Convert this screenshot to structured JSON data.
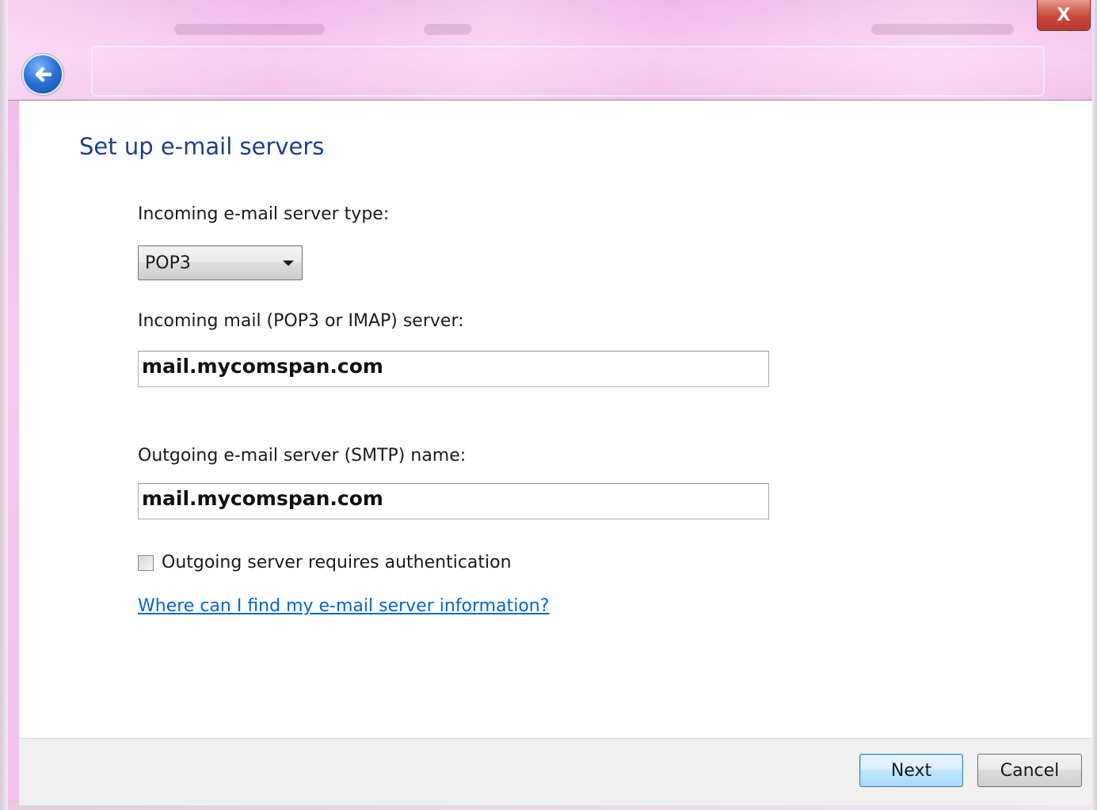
{
  "window": {
    "close_glyph": "X",
    "accent_color": "#1e3f8c"
  },
  "nav": {
    "back_icon": "back-arrow-icon"
  },
  "page": {
    "heading": "Set up e-mail servers"
  },
  "form": {
    "incoming_type_label": "Incoming e-mail server type:",
    "incoming_type_value": "POP3",
    "incoming_server_label": "Incoming mail (POP3 or IMAP) server:",
    "incoming_server_value": "mail.mycomspan.com",
    "outgoing_server_label": "Outgoing e-mail server (SMTP) name:",
    "outgoing_server_value": "mail.mycomspan.com",
    "auth_checkbox_label": "Outgoing server requires authentication",
    "auth_checked": false,
    "help_link": "Where can I find my e-mail server information?"
  },
  "footer": {
    "next_label": "Next",
    "cancel_label": "Cancel"
  }
}
